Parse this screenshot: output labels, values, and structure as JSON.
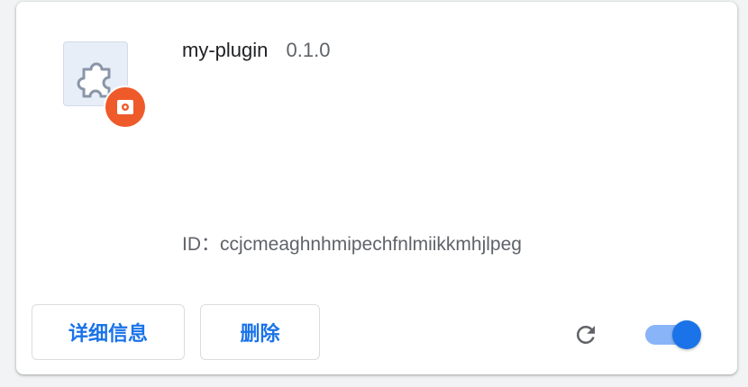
{
  "extension": {
    "name": "my-plugin",
    "version": "0.1.0",
    "id_label": "ID：",
    "id_value": "ccjcmeaghnhmipechfnlmiikkmhjlpeg",
    "icon": "puzzle-piece-icon",
    "badge_icon": "policy-badge-icon",
    "enabled": true
  },
  "actions": {
    "details_label": "详细信息",
    "remove_label": "删除",
    "reload_icon": "reload-icon"
  },
  "colors": {
    "accent": "#1a73e8",
    "toggle_track": "#8ab4f8",
    "badge": "#ee5a2a"
  }
}
